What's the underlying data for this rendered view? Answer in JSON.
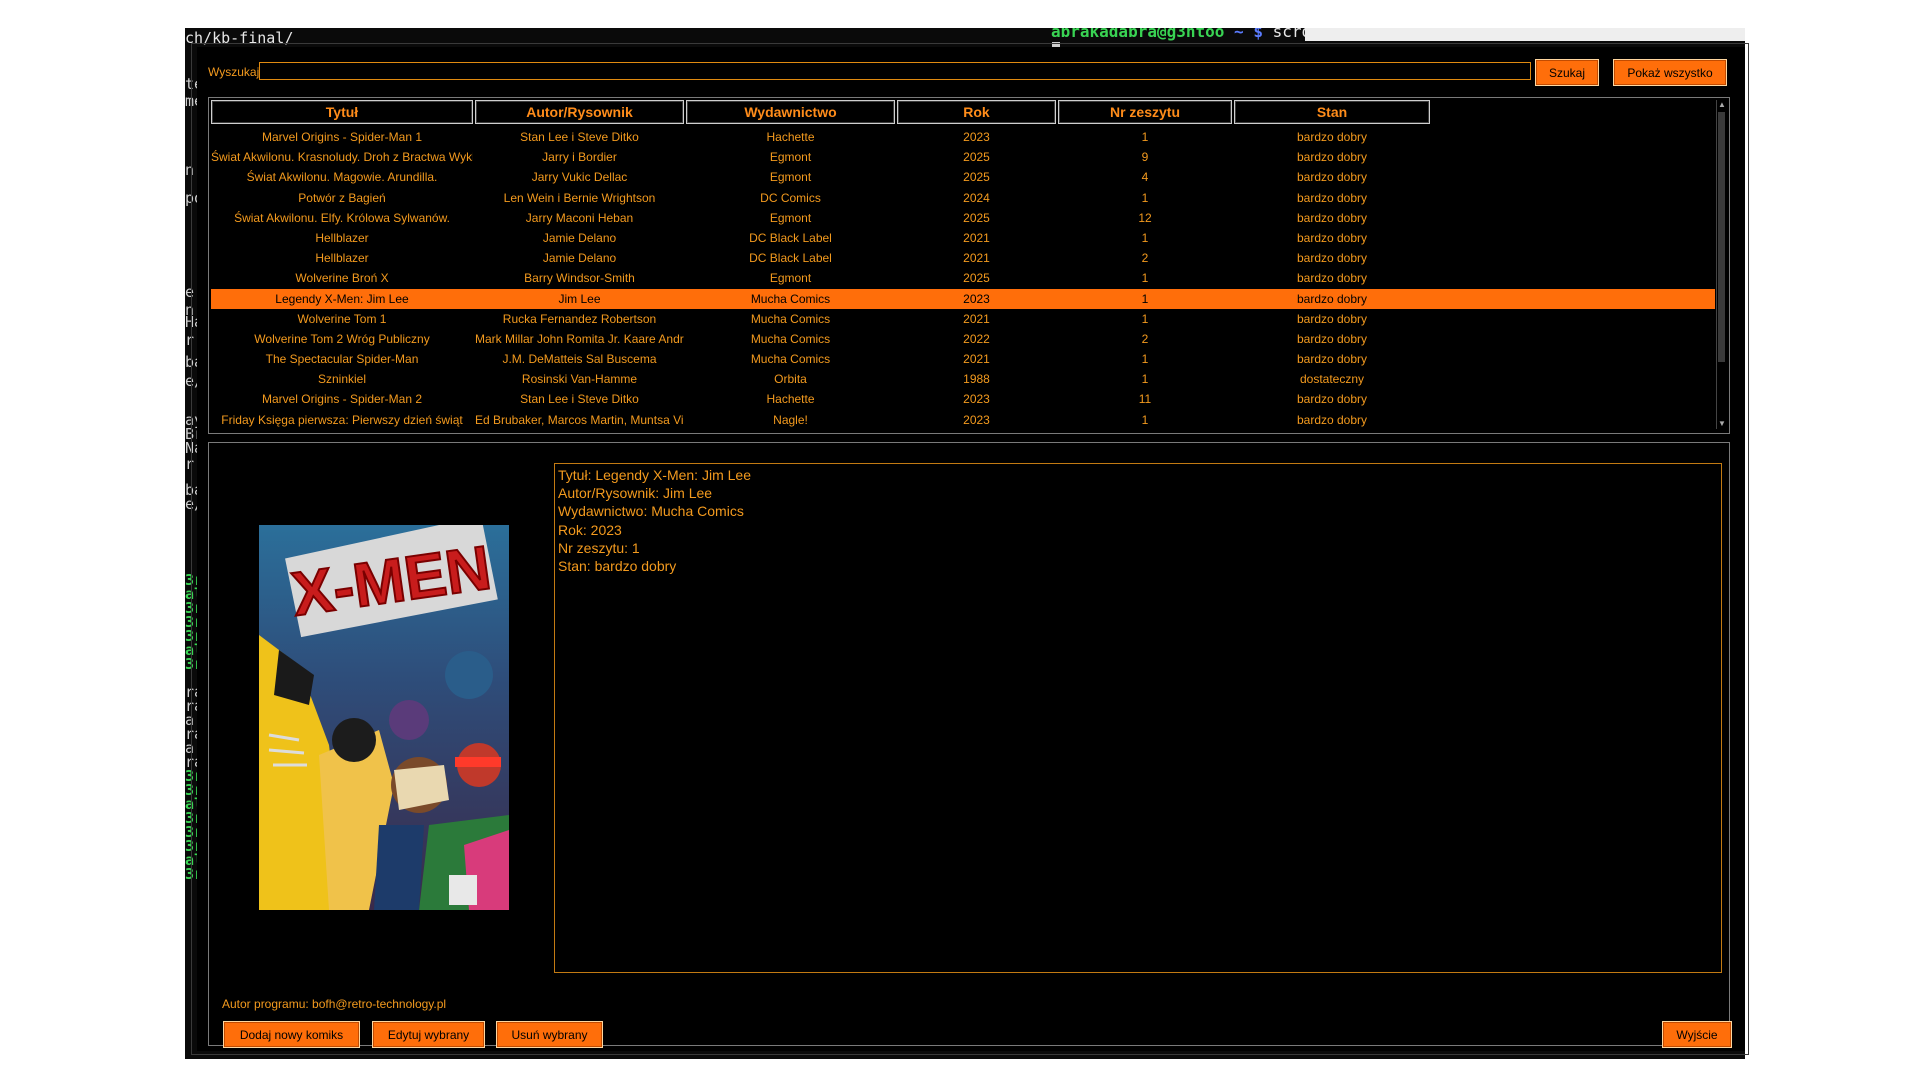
{
  "terminal": {
    "path_text": "ch/kb-final/",
    "prompt": {
      "user_host": "abrakadabra@g3ntoo",
      "tilde": "~",
      "dollar": "$",
      "command": "scrot"
    },
    "left_fragments": [
      {
        "text": "te",
        "green": false
      },
      {
        "text": "me",
        "green": false
      },
      {
        "text": "n",
        "green": false
      },
      {
        "text": "po",
        "green": false
      },
      {
        "text": "e",
        "green": false
      },
      {
        "text": "n",
        "green": false
      },
      {
        "text": "Ha",
        "green": false
      },
      {
        "text": "r",
        "green": false
      },
      {
        "text": "ba",
        "green": false
      },
      {
        "text": "e/",
        "green": false
      },
      {
        "text": "ay",
        "green": false
      },
      {
        "text": "Br",
        "green": false
      },
      {
        "text": "Na",
        "green": false
      },
      {
        "text": "r",
        "green": false
      },
      {
        "text": "ba",
        "green": false
      },
      {
        "text": "e/",
        "green": false
      },
      {
        "text": "3r",
        "green": true
      },
      {
        "text": "al",
        "green": true
      },
      {
        "text": "3r",
        "green": true
      },
      {
        "text": "3r",
        "green": true
      },
      {
        "text": "3r",
        "green": true
      },
      {
        "text": "al",
        "green": true
      },
      {
        "text": "3r",
        "green": true
      },
      {
        "text": "ra",
        "green": false
      },
      {
        "text": "ra",
        "green": false
      },
      {
        "text": "a",
        "green": false
      },
      {
        "text": "ra",
        "green": false
      },
      {
        "text": "a",
        "green": false
      },
      {
        "text": "ra",
        "green": false
      },
      {
        "text": "3r",
        "green": true
      },
      {
        "text": "3r",
        "green": true
      },
      {
        "text": "al",
        "green": true
      },
      {
        "text": "3r",
        "green": true
      },
      {
        "text": "3r",
        "green": true
      },
      {
        "text": "3r",
        "green": true
      },
      {
        "text": "al",
        "green": true
      },
      {
        "text": "3r",
        "green": true
      }
    ]
  },
  "search": {
    "label": "Wyszukaj:",
    "value": "",
    "placeholder": ""
  },
  "buttons": {
    "search": "Szukaj",
    "show_all": "Pokaż wszystko",
    "add": "Dodaj nowy komiks",
    "edit": "Edytuj wybrany",
    "delete": "Usuń wybrany",
    "exit": "Wyjście"
  },
  "table": {
    "columns": [
      "Tytuł",
      "Autor/Rysownik",
      "Wydawnictwo",
      "Rok",
      "Nr zeszytu",
      "Stan"
    ],
    "selected_index": 8,
    "rows": [
      [
        "Marvel Origins - Spider-Man 1",
        "Stan Lee i Steve Ditko",
        "Hachette",
        "2023",
        "1",
        "bardzo dobry"
      ],
      [
        "Świat Akwilonu. Krasnoludy. Droh z Bractwa Wyklucz",
        "Jarry i Bordier",
        "Egmont",
        "2025",
        "9",
        "bardzo dobry"
      ],
      [
        "Świat Akwilonu. Magowie. Arundilla.",
        "Jarry Vukic Dellac",
        "Egmont",
        "2025",
        "4",
        "bardzo dobry"
      ],
      [
        "Potwór z Bagień",
        "Len Wein i Bernie Wrightson",
        "DC Comics",
        "2024",
        "1",
        "bardzo dobry"
      ],
      [
        "Świat Akwilonu. Elfy. Królowa Sylwanów.",
        "Jarry Maconi Heban",
        "Egmont",
        "2025",
        "12",
        "bardzo dobry"
      ],
      [
        "Hellblazer",
        "Jamie Delano",
        "DC Black Label",
        "2021",
        "1",
        "bardzo dobry"
      ],
      [
        "Hellblazer",
        "Jamie Delano",
        "DC Black Label",
        "2021",
        "2",
        "bardzo dobry"
      ],
      [
        "Wolverine Broń X",
        "Barry Windsor-Smith",
        "Egmont",
        "2025",
        "1",
        "bardzo dobry"
      ],
      [
        "Legendy X-Men: Jim Lee",
        "Jim Lee",
        "Mucha Comics",
        "2023",
        "1",
        "bardzo dobry"
      ],
      [
        "Wolverine Tom 1",
        "Rucka Fernandez Robertson",
        "Mucha Comics",
        "2021",
        "1",
        "bardzo dobry"
      ],
      [
        "Wolverine Tom 2 Wróg Publiczny",
        "Mark Millar John Romita Jr. Kaare Andrews",
        "Mucha Comics",
        "2022",
        "2",
        "bardzo dobry"
      ],
      [
        "The Spectacular Spider-Man",
        "J.M. DeMatteis Sal Buscema",
        "Mucha Comics",
        "2021",
        "1",
        "bardzo dobry"
      ],
      [
        "Szninkiel",
        "Rosinski Van-Hamme",
        "Orbita",
        "1988",
        "1",
        "dostateczny"
      ],
      [
        "Marvel Origins - Spider-Man 2",
        "Stan Lee i Steve Ditko",
        "Hachette",
        "2023",
        "11",
        "bardzo dobry"
      ],
      [
        "Friday Księga pierwsza: Pierwszy dzień świąt",
        "Ed Brubaker, Marcos Martin, Muntsa Vicente",
        "Nagle!",
        "2023",
        "1",
        "bardzo dobry"
      ]
    ]
  },
  "details": {
    "cover_logo": "X-MEN",
    "lines": [
      "Tytuł: Legendy X-Men: Jim Lee",
      "Autor/Rysownik: Jim Lee",
      "Wydawnictwo: Mucha Comics",
      "Rok: 2023",
      "Nr zeszytu: 1",
      "Stan: bardzo dobry"
    ]
  },
  "footer": {
    "author_note": "Autor programu: bofh@retro-technology.pl"
  },
  "colors": {
    "accent": "#ff6e0a",
    "text": "#f39a1e",
    "background": "#000000"
  }
}
